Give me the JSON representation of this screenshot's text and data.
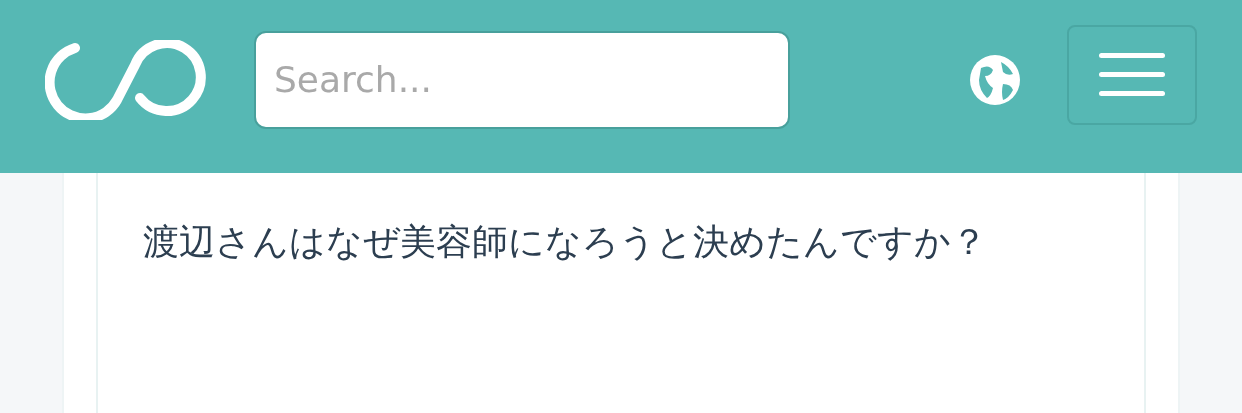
{
  "header": {
    "search": {
      "placeholder": "Search..."
    }
  },
  "question": {
    "text": "渡辺さんはなぜ美容師になろうと決めたんですか？"
  }
}
